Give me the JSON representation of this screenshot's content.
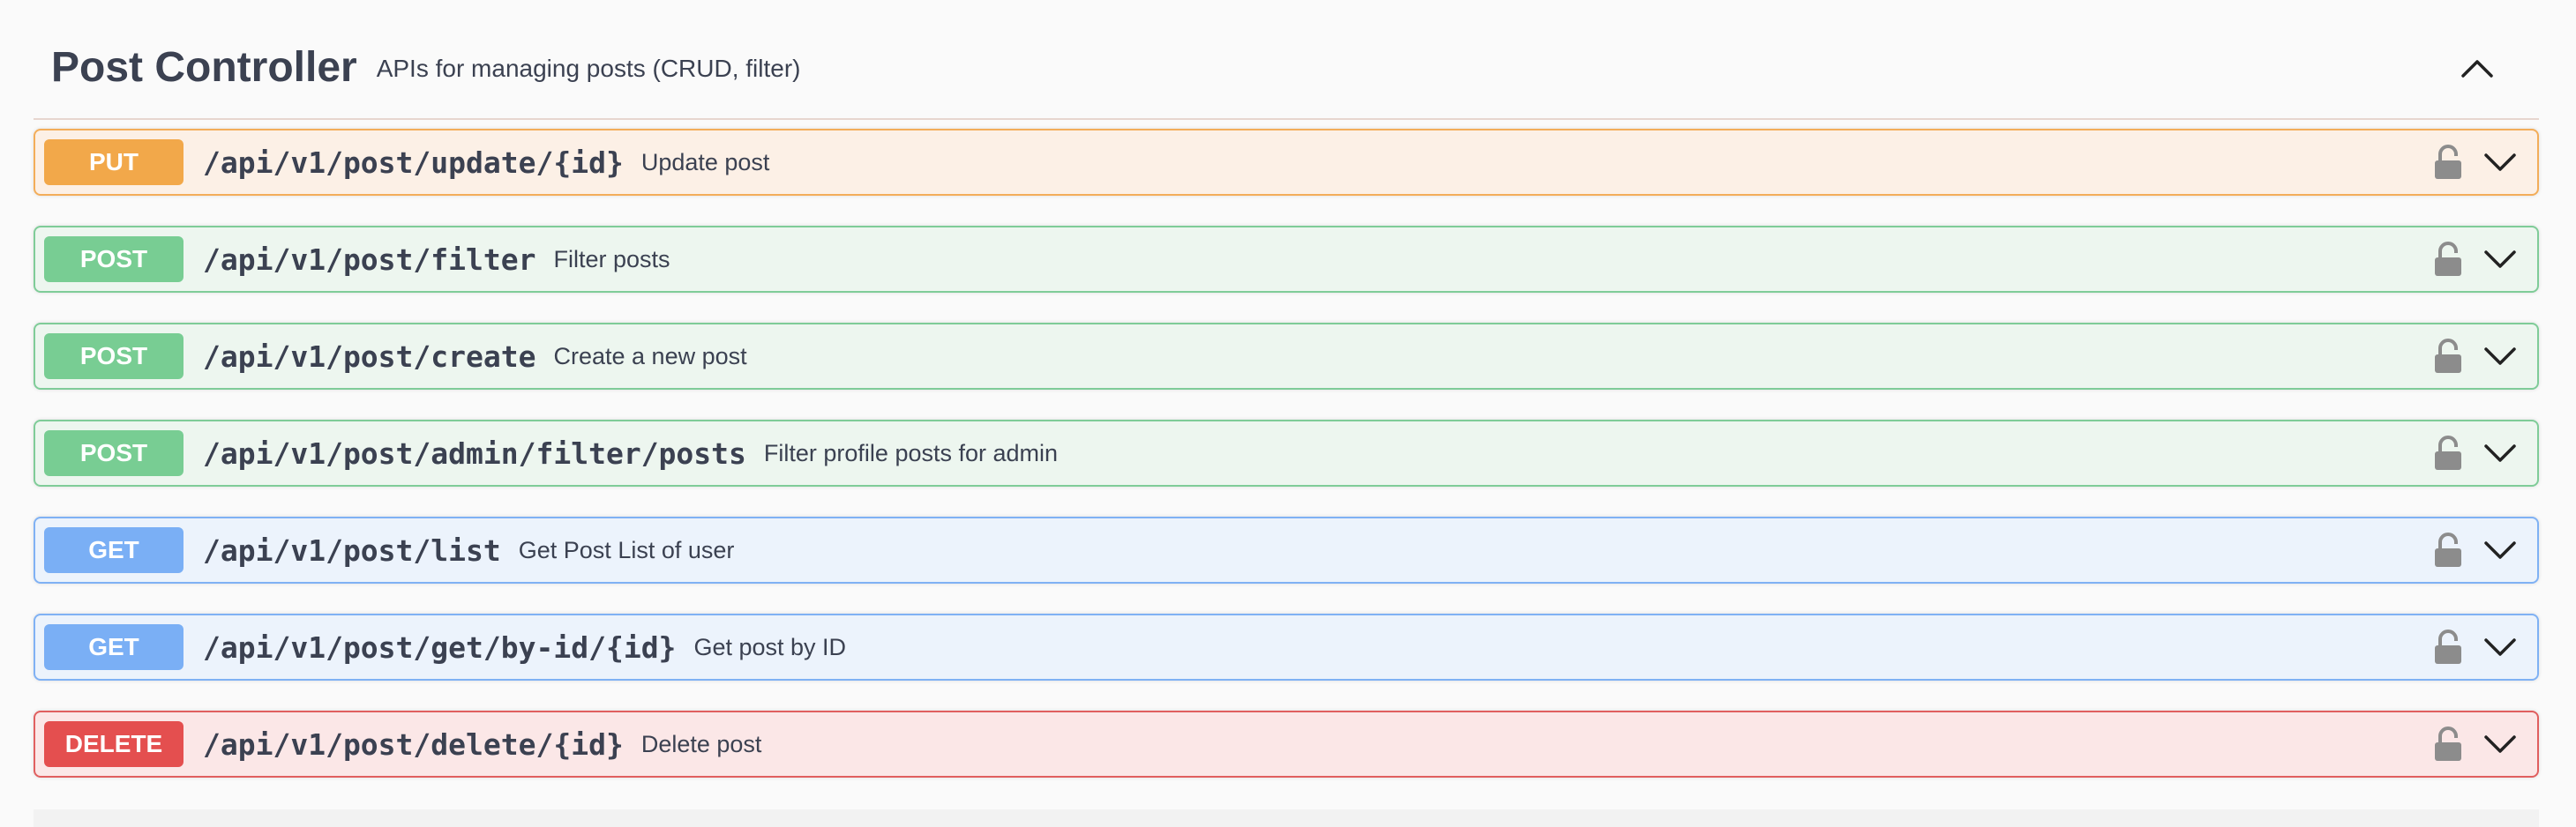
{
  "tag": {
    "title": "Post Controller",
    "description": "APIs for managing posts (CRUD, filter)"
  },
  "colors": {
    "put": "#f2a84a",
    "post": "#78cd93",
    "get": "#7aaff5",
    "delete": "#e44f4f",
    "text": "#3b4151",
    "icon": "#8c8c8c"
  },
  "icons": {
    "collapse": "chevron-up-icon",
    "expand": "chevron-down-icon",
    "auth": "lock-icon"
  },
  "operations": [
    {
      "method": "PUT",
      "path": "/api/v1/post/update/{id}",
      "summary": "Update post"
    },
    {
      "method": "POST",
      "path": "/api/v1/post/filter",
      "summary": "Filter posts"
    },
    {
      "method": "POST",
      "path": "/api/v1/post/create",
      "summary": "Create a new post"
    },
    {
      "method": "POST",
      "path": "/api/v1/post/admin/filter/posts",
      "summary": "Filter profile posts for admin"
    },
    {
      "method": "GET",
      "path": "/api/v1/post/list",
      "summary": "Get Post List of user"
    },
    {
      "method": "GET",
      "path": "/api/v1/post/get/by-id/{id}",
      "summary": "Get post by ID"
    },
    {
      "method": "DELETE",
      "path": "/api/v1/post/delete/{id}",
      "summary": "Delete post"
    }
  ]
}
